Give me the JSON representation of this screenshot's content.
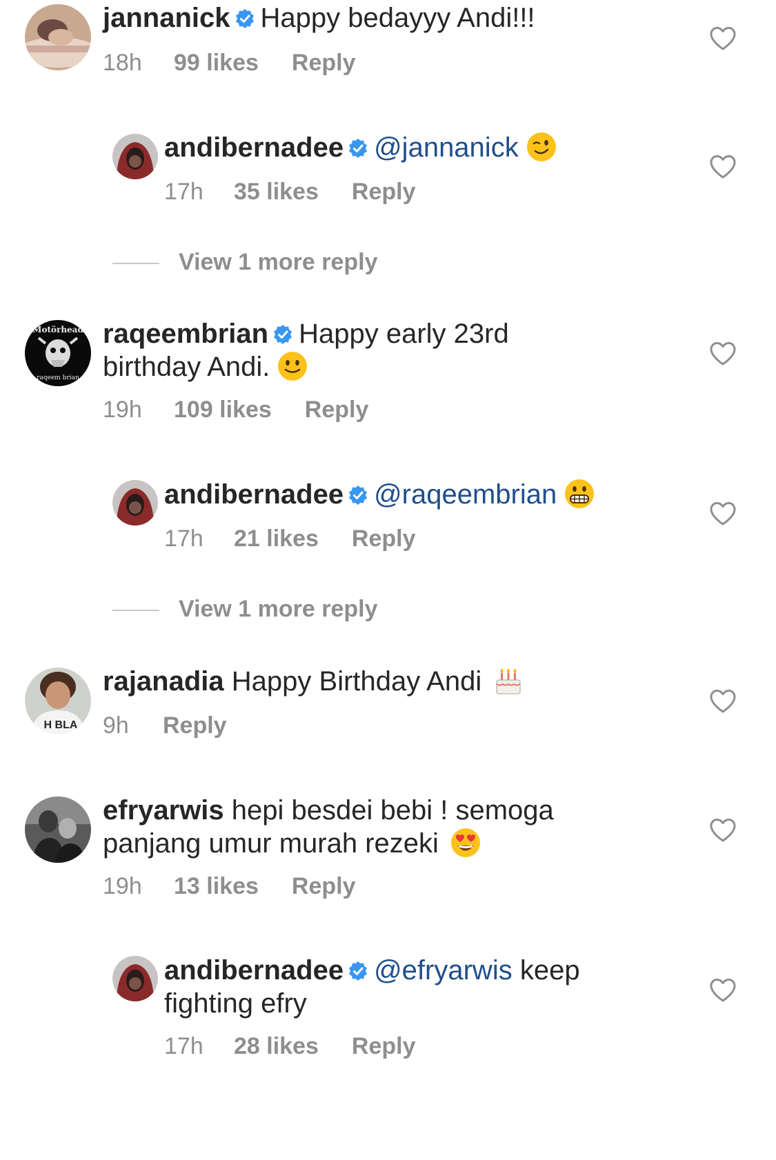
{
  "comments": [
    {
      "username": "jannanick",
      "verified": true,
      "text": "Happy bedayyy Andi!!!",
      "time": "18h",
      "likes": "99 likes",
      "reply": "Reply"
    },
    {
      "username": "andibernadee",
      "verified": true,
      "mention": "@jannanick",
      "emoji": "winking-face",
      "time": "17h",
      "likes": "35 likes",
      "reply": "Reply"
    },
    {
      "view_more": "View 1 more reply"
    },
    {
      "username": "raqeembrian",
      "verified": true,
      "text_line1": "Happy early 23rd",
      "text_line2": "birthday Andi.",
      "emoji": "slightly-smiling-face",
      "avatar_text_top": "Motörhead",
      "avatar_text_bottom": "raqeem brian",
      "time": "19h",
      "likes": "109 likes",
      "reply": "Reply"
    },
    {
      "username": "andibernadee",
      "verified": true,
      "mention": "@raqeembrian",
      "emoji": "grimacing-face",
      "time": "17h",
      "likes": "21 likes",
      "reply": "Reply"
    },
    {
      "view_more": "View 1 more reply"
    },
    {
      "username": "rajanadia",
      "verified": false,
      "text": "Happy Birthday Andi",
      "emoji": "birthday-cake",
      "avatar_text": "H BLA",
      "time": "9h",
      "reply": "Reply"
    },
    {
      "username": "efryarwis",
      "verified": false,
      "text_line1": "hepi besdei bebi ! semoga",
      "text_line2": "panjang umur murah rezeki",
      "emoji": "smiling-face-with-heart-eyes",
      "time": "19h",
      "likes": "13 likes",
      "reply": "Reply"
    },
    {
      "username": "andibernadee",
      "verified": true,
      "mention": "@efryarwis",
      "text_after_mention": "keep",
      "text_line2": "fighting efry",
      "time": "17h",
      "likes": "28 likes",
      "reply": "Reply"
    }
  ],
  "colors": {
    "text": "#262626",
    "secondary": "#8e8e8e",
    "mention": "#1f4e8c",
    "verified_badge": "#3897f0"
  }
}
